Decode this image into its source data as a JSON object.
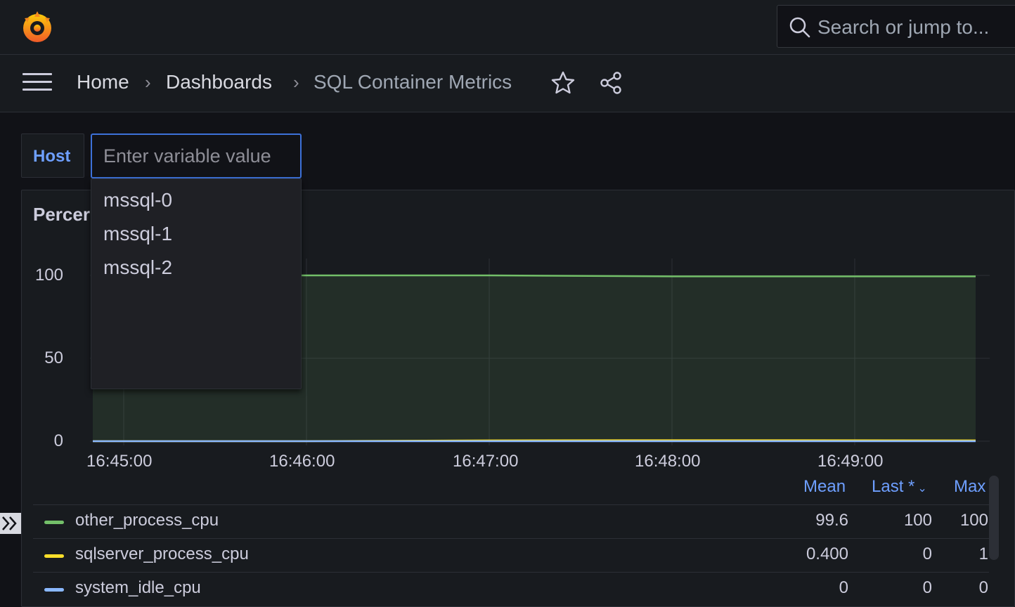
{
  "colors": {
    "accent": "#6e9fff",
    "series_green": "#73bf69",
    "series_yellow": "#fade2a",
    "series_blue": "#8ab8ff"
  },
  "topbar": {
    "logo_icon": "grafana-logo-icon",
    "search_placeholder": "Search or jump to..."
  },
  "breadcrumb": {
    "items": [
      "Home",
      "Dashboards",
      "SQL Container Metrics"
    ]
  },
  "variable": {
    "label": "Host",
    "placeholder": "Enter variable value",
    "options": [
      "mssql-0",
      "mssql-1",
      "mssql-2"
    ]
  },
  "panel": {
    "title": "Percer"
  },
  "chart_data": {
    "type": "area",
    "x": [
      "16:45:00",
      "16:46:00",
      "16:47:00",
      "16:48:00",
      "16:49:00"
    ],
    "ylim": [
      0,
      100
    ],
    "yticks": [
      0,
      50,
      100
    ],
    "series": [
      {
        "name": "other_process_cpu",
        "color": "#73bf69",
        "values": [
          100,
          100,
          100,
          99.4,
          99.4
        ]
      },
      {
        "name": "sqlserver_process_cpu",
        "color": "#fade2a",
        "values": [
          0,
          0,
          0.5,
          0.6,
          0.5
        ]
      },
      {
        "name": "system_idle_cpu",
        "color": "#8ab8ff",
        "values": [
          0,
          0,
          0,
          0,
          0
        ]
      }
    ]
  },
  "legend": {
    "headers": {
      "mean": "Mean",
      "last": "Last *",
      "max": "Max"
    },
    "rows": [
      {
        "name": "other_process_cpu",
        "mean": "99.6",
        "last": "100",
        "max": "100"
      },
      {
        "name": "sqlserver_process_cpu",
        "mean": "0.400",
        "last": "0",
        "max": "1"
      },
      {
        "name": "system_idle_cpu",
        "mean": "0",
        "last": "0",
        "max": "0"
      }
    ]
  }
}
